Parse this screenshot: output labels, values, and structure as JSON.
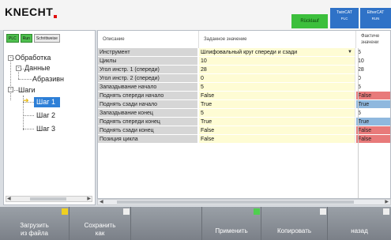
{
  "app": {
    "logo": "KNECHT"
  },
  "status": {
    "green": "Rücklauf",
    "b1": {
      "line1": "TwinCAT",
      "line2": "PLC"
    },
    "b2": {
      "line1": "EtherCAT",
      "line2": "RUN"
    }
  },
  "tree_toolbar": {
    "btn1": "PLC",
    "btn2": "Run",
    "btn3": "Schrittweise"
  },
  "tree": {
    "root": "Обработка",
    "data": "Данные",
    "abr": "Абразивн",
    "steps": "Шаги",
    "s1": "Шаг 1",
    "s2": "Шаг 2",
    "s3": "Шаг 3"
  },
  "table": {
    "headers": {
      "c1": "Описание",
      "c2": "Заданное значение",
      "c3a": "Фактиче",
      "c3b": "значени"
    },
    "rows": [
      {
        "k": "Инструмент",
        "v": "Шлифовальный круг спереди и сзади",
        "a": "5",
        "dropdown": true,
        "aclass": ""
      },
      {
        "k": "Циклы",
        "v": "10",
        "a": "10",
        "aclass": ""
      },
      {
        "k": "Угол инстр. 1 (спереди)",
        "v": "28",
        "a": "28",
        "aclass": ""
      },
      {
        "k": "Угол инстр. 2 (спереди)",
        "v": "0",
        "a": "0",
        "aclass": ""
      },
      {
        "k": "Запаздывание начало",
        "v": "5",
        "a": "5",
        "aclass": ""
      },
      {
        "k": "Поднять спереди начало",
        "v": "False",
        "a": "False",
        "aclass": "red"
      },
      {
        "k": "Поднять сзади начало",
        "v": "True",
        "a": "True",
        "aclass": "blue"
      },
      {
        "k": "Запаздывание конец",
        "v": "5",
        "a": "5",
        "aclass": ""
      },
      {
        "k": "Поднять спереди конец",
        "v": "True",
        "a": "True",
        "aclass": "blue"
      },
      {
        "k": "Поднять сзади конец",
        "v": "False",
        "a": "False",
        "aclass": "red"
      },
      {
        "k": "Позиция цикла",
        "v": "False",
        "a": "False",
        "aclass": "red"
      }
    ]
  },
  "bottom": {
    "load": "Загрузить\nиз файла",
    "save": "Сохранить\nкак",
    "apply": "Применить",
    "copy": "Копировать",
    "back": "назад"
  },
  "colors": {
    "accent": "#2d7fd7",
    "flag_false": "#e87a7a",
    "flag_true": "#8fb8de"
  }
}
